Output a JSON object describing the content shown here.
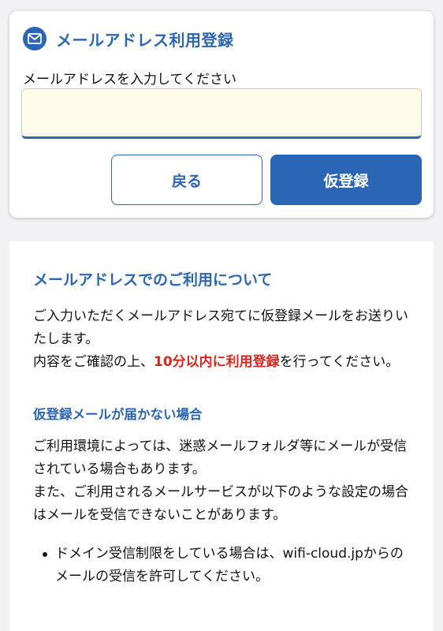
{
  "colors": {
    "accent": "#2a66b3",
    "alert": "#d8261c",
    "input_bg": "#fffdea"
  },
  "form": {
    "icon": "mail-icon",
    "title": "メールアドレス利用登録",
    "email_label": "メールアドレスを入力してください",
    "email_value": "",
    "email_placeholder": "",
    "back_label": "戻る",
    "register_label": "仮登録"
  },
  "info": {
    "heading": "メールアドレスでのご利用について",
    "para1_line1": "ご入力いただくメールアドレス宛てに仮登録メールをお送りいたします。",
    "para1_line2_pre": "内容をご確認の上、",
    "para1_line2_em": "10分以内に利用登録",
    "para1_line2_post": "を行ってください。",
    "sub_heading": "仮登録メールが届かない場合",
    "para2_line1": "ご利用環境によっては、迷惑メールフォルダ等にメールが受信されている場合もあります。",
    "para2_line2": "また、ご利用されるメールサービスが以下のような設定の場合はメールを受信できないことがあります。",
    "bullets": [
      "ドメイン受信制限をしている場合は、wifi-cloud.jpからのメールの受信を許可してください。"
    ]
  }
}
